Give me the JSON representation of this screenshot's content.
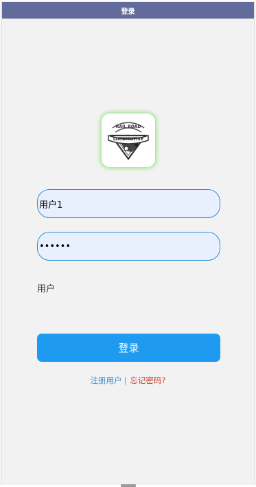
{
  "app": {
    "title": "登录"
  },
  "logo": {
    "top_text": "RAIL ROAD",
    "banner_text": "LOCOMOTIVE",
    "icon": "locomotive-logo-icon"
  },
  "form": {
    "username_value": "用户1",
    "password_value": "••••••",
    "role_label": "用户"
  },
  "buttons": {
    "login_label": "登录"
  },
  "links": {
    "register": "注册用户",
    "separator": "|",
    "forgot": "忘记密码?"
  },
  "colors": {
    "titlebar": "#636a9c",
    "primary": "#1e9af0",
    "input_bg": "#e8f0fe",
    "input_border": "#2c8fd8",
    "register_link": "#3b8fd0",
    "forgot_link": "#d03a30",
    "logo_glow": "#9be28a"
  }
}
